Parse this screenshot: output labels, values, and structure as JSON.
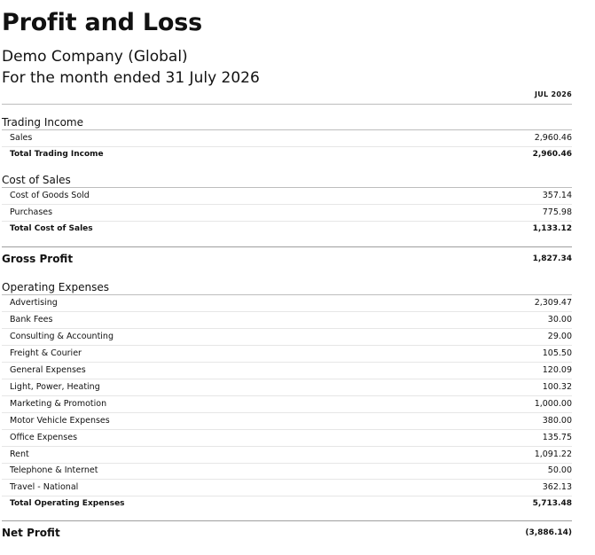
{
  "report": {
    "title": "Profit and Loss",
    "company": "Demo Company (Global)",
    "period": "For the month ended 31 July 2026",
    "column_header": "JUL 2026"
  },
  "trading_income": {
    "heading": "Trading Income",
    "rows": [
      {
        "label": "Sales",
        "value": "2,960.46"
      }
    ],
    "total": {
      "label": "Total Trading Income",
      "value": "2,960.46"
    }
  },
  "cost_of_sales": {
    "heading": "Cost of Sales",
    "rows": [
      {
        "label": "Cost of Goods Sold",
        "value": "357.14"
      },
      {
        "label": "Purchases",
        "value": "775.98"
      }
    ],
    "total": {
      "label": "Total Cost of Sales",
      "value": "1,133.12"
    }
  },
  "gross_profit": {
    "label": "Gross Profit",
    "value": "1,827.34"
  },
  "operating_expenses": {
    "heading": "Operating Expenses",
    "rows": [
      {
        "label": "Advertising",
        "value": "2,309.47"
      },
      {
        "label": "Bank Fees",
        "value": "30.00"
      },
      {
        "label": "Consulting & Accounting",
        "value": "29.00"
      },
      {
        "label": "Freight & Courier",
        "value": "105.50"
      },
      {
        "label": "General Expenses",
        "value": "120.09"
      },
      {
        "label": "Light, Power, Heating",
        "value": "100.32"
      },
      {
        "label": "Marketing & Promotion",
        "value": "1,000.00"
      },
      {
        "label": "Motor Vehicle Expenses",
        "value": "380.00"
      },
      {
        "label": "Office Expenses",
        "value": "135.75"
      },
      {
        "label": "Rent",
        "value": "1,091.22"
      },
      {
        "label": "Telephone & Internet",
        "value": "50.00"
      },
      {
        "label": "Travel - National",
        "value": "362.13"
      }
    ],
    "total": {
      "label": "Total Operating Expenses",
      "value": "5,713.48"
    }
  },
  "net_profit": {
    "label": "Net Profit",
    "value": "(3,886.14)"
  }
}
